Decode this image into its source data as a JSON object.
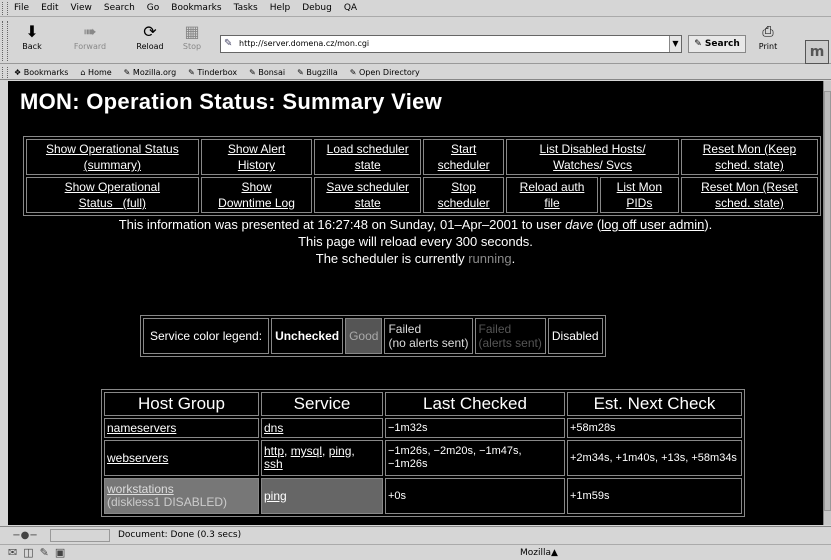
{
  "menu": [
    "File",
    "Edit",
    "View",
    "Search",
    "Go",
    "Bookmarks",
    "Tasks",
    "Help",
    "Debug",
    "QA"
  ],
  "nav": {
    "back": "Back",
    "forward": "Forward",
    "reload": "Reload",
    "stop": "Stop",
    "url": "http://server.domena.cz/mon.cgi",
    "search": "Search",
    "print": "Print"
  },
  "bookmarks": [
    "Bookmarks",
    "Home",
    "Mozilla.org",
    "Tinderbox",
    "Bonsai",
    "Bugzilla",
    "Open Directory"
  ],
  "page": {
    "title": "MON: Operation Status: Summary View",
    "ops_row1": [
      [
        "Show Operational Status",
        "(summary)"
      ],
      [
        "Show Alert",
        "History"
      ],
      [
        "Load scheduler",
        "state"
      ],
      [
        "Start",
        "scheduler"
      ],
      [
        "List Disabled Hosts/",
        "Watches/ Svcs"
      ],
      [
        "Reset Mon (Keep",
        "sched. state)"
      ]
    ],
    "ops_row2": [
      [
        "Show Operational",
        "Status   (full)"
      ],
      [
        "Show",
        "Downtime Log"
      ],
      [
        "Save scheduler",
        "state"
      ],
      [
        "Stop",
        "scheduler"
      ],
      [
        "Reload auth",
        "file"
      ],
      [
        "List Mon",
        "PIDs"
      ],
      [
        "Reset Mon (Reset",
        "sched. state)"
      ]
    ],
    "info_pre": "This information was presented at 16:27:48 on Sunday, 01–Apr–2001 to user ",
    "info_user": "dave",
    "info_link": "log off user admin",
    "info_paren_open": " (",
    "info_paren_close": ").",
    "reload_line": "This page will reload every 300 seconds.",
    "sched_pre": "The scheduler is currently ",
    "sched_state": "running",
    "sched_post": ".",
    "legend": {
      "label": "Service color legend:",
      "unchecked": "Unchecked",
      "good": "Good",
      "failed_line1": "Failed",
      "failed_line2": "(no alerts sent)",
      "failsent_line1": "Failed",
      "failsent_line2": "(alerts sent)",
      "disabled": "Disabled"
    },
    "host_table": {
      "headers": [
        "Host Group",
        "Service",
        "Last Checked",
        "Est. Next Check"
      ],
      "rows": [
        {
          "group": "nameservers",
          "group_note": "",
          "services": [
            "dns"
          ],
          "last": "−1m32s",
          "next": "+58m28s"
        },
        {
          "group": "webservers",
          "group_note": "",
          "services": [
            "http",
            "mysql",
            "ping",
            "ssh"
          ],
          "last": "−1m26s, −2m20s, −1m47s, −1m26s",
          "next": "+2m34s, +1m40s, +13s, +58m34s"
        },
        {
          "group": "workstations",
          "group_note": "(diskless1 DISABLED)",
          "services": [
            "ping"
          ],
          "last": "+0s",
          "next": "+1m59s"
        }
      ]
    }
  },
  "status": {
    "text": "Document: Done (0.3 secs)"
  },
  "taskbar": {
    "label": "Mozilla"
  }
}
